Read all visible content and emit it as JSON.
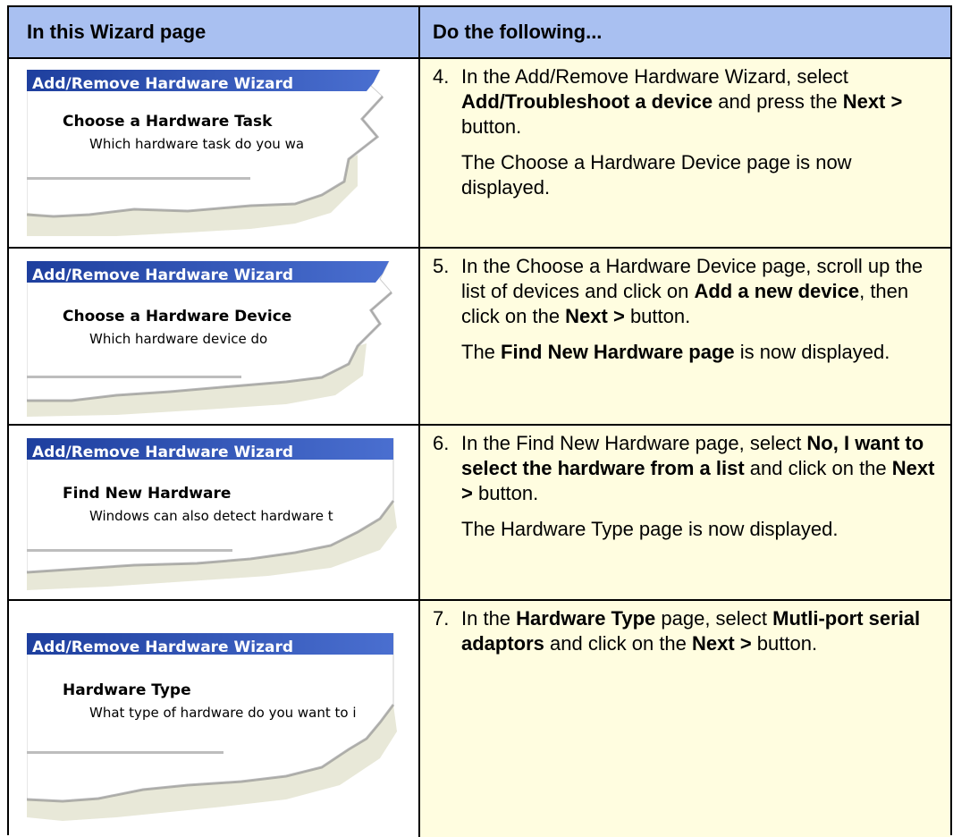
{
  "header": {
    "col1": "In this Wizard page",
    "col2": "Do the following..."
  },
  "colors": {
    "header_bg": "#a9c0f1",
    "right_cell_bg": "#fffde0",
    "wizard_titlebar": "#2b4fb3"
  },
  "rows": [
    {
      "wizard": {
        "title": "Add/Remove Hardware Wizard",
        "page_title": "Choose a Hardware Task",
        "page_subtitle": "Which hardware task do you wa"
      },
      "step": {
        "num": "4.",
        "p1": "In the Add/Remove Hardware Wizard, select ",
        "b1": "Add/Troubleshoot a device",
        "p2": " and press the ",
        "b2": "Next >",
        "p3": " button.",
        "note": "The Choose a Hardware Device page is now displayed."
      }
    },
    {
      "wizard": {
        "title": "Add/Remove Hardware Wizard",
        "page_title": "Choose a Hardware Device",
        "page_subtitle": "Which hardware device do"
      },
      "step": {
        "num": "5.",
        "p1": "In the Choose a Hardware Device page, scroll up the list of devices and click on ",
        "b1": "Add a new device",
        "p2": ", then click on the ",
        "b2": "Next >",
        "p3": " button.",
        "note_b": "Find New Hardware page",
        "note_pre": "The ",
        "note_post": " is now displayed."
      }
    },
    {
      "wizard": {
        "title": "Add/Remove Hardware Wizard",
        "page_title": "Find New Hardware",
        "page_subtitle": "Windows can also detect hardware t"
      },
      "step": {
        "num": "6.",
        "p1": "In the Find New Hardware page, select ",
        "b1": "No, I want to select the hardware from a list",
        "p2": " and click on the ",
        "b2": "Next >",
        "p3": " button.",
        "note": "The Hardware Type page is now displayed."
      }
    },
    {
      "wizard": {
        "title": "Add/Remove Hardware Wizard",
        "page_title": "Hardware Type",
        "page_subtitle": "What type of hardware do you want to i"
      },
      "step": {
        "num": "7.",
        "p1": "In the ",
        "b1": "Hardware Type",
        "p2": " page, select ",
        "b2": "Mutli-port serial adaptors",
        "p3": " and click on the ",
        "b3": "Next >",
        "p4": " button."
      }
    }
  ]
}
